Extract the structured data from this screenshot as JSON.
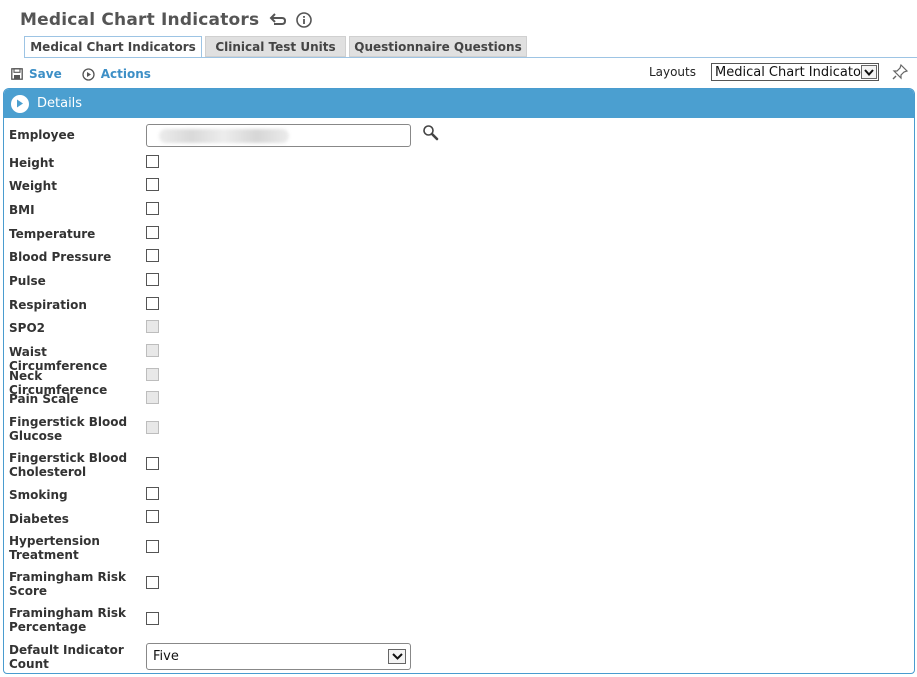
{
  "page": {
    "title": "Medical Chart Indicators"
  },
  "tabs": [
    {
      "label": "Medical Chart Indicators",
      "active": true
    },
    {
      "label": "Clinical Test Units",
      "active": false
    },
    {
      "label": "Questionnaire Questions",
      "active": false
    }
  ],
  "toolbar": {
    "save_label": "Save",
    "actions_label": "Actions"
  },
  "layouts": {
    "label": "Layouts",
    "selected": "Medical Chart Indicato..."
  },
  "panel": {
    "title": "Details"
  },
  "form": {
    "employee_label": "Employee",
    "employee_value": "",
    "fields": [
      {
        "label": "Height",
        "checked": false,
        "disabled": false
      },
      {
        "label": "Weight",
        "checked": false,
        "disabled": false
      },
      {
        "label": "BMI",
        "checked": false,
        "disabled": false
      },
      {
        "label": "Temperature",
        "checked": false,
        "disabled": false
      },
      {
        "label": "Blood Pressure",
        "checked": false,
        "disabled": false
      },
      {
        "label": "Pulse",
        "checked": false,
        "disabled": false
      },
      {
        "label": "Respiration",
        "checked": false,
        "disabled": false
      },
      {
        "label": "SPO2",
        "checked": false,
        "disabled": true
      },
      {
        "label": "Waist Circumference",
        "checked": false,
        "disabled": true
      },
      {
        "label": "Neck Circumference",
        "checked": false,
        "disabled": true
      },
      {
        "label": "Pain Scale",
        "checked": false,
        "disabled": true
      },
      {
        "label": "Fingerstick Blood Glucose",
        "checked": false,
        "disabled": true
      },
      {
        "label": "Fingerstick Blood Cholesterol",
        "checked": false,
        "disabled": false
      },
      {
        "label": "Smoking",
        "checked": false,
        "disabled": false
      },
      {
        "label": "Diabetes",
        "checked": false,
        "disabled": false
      },
      {
        "label": "Hypertension Treatment",
        "checked": false,
        "disabled": false
      },
      {
        "label": "Framingham Risk Score",
        "checked": false,
        "disabled": false
      },
      {
        "label": "Framingham Risk Percentage",
        "checked": false,
        "disabled": false
      }
    ],
    "default_count_label": "Default Indicator Count",
    "default_count_value": "Five"
  }
}
